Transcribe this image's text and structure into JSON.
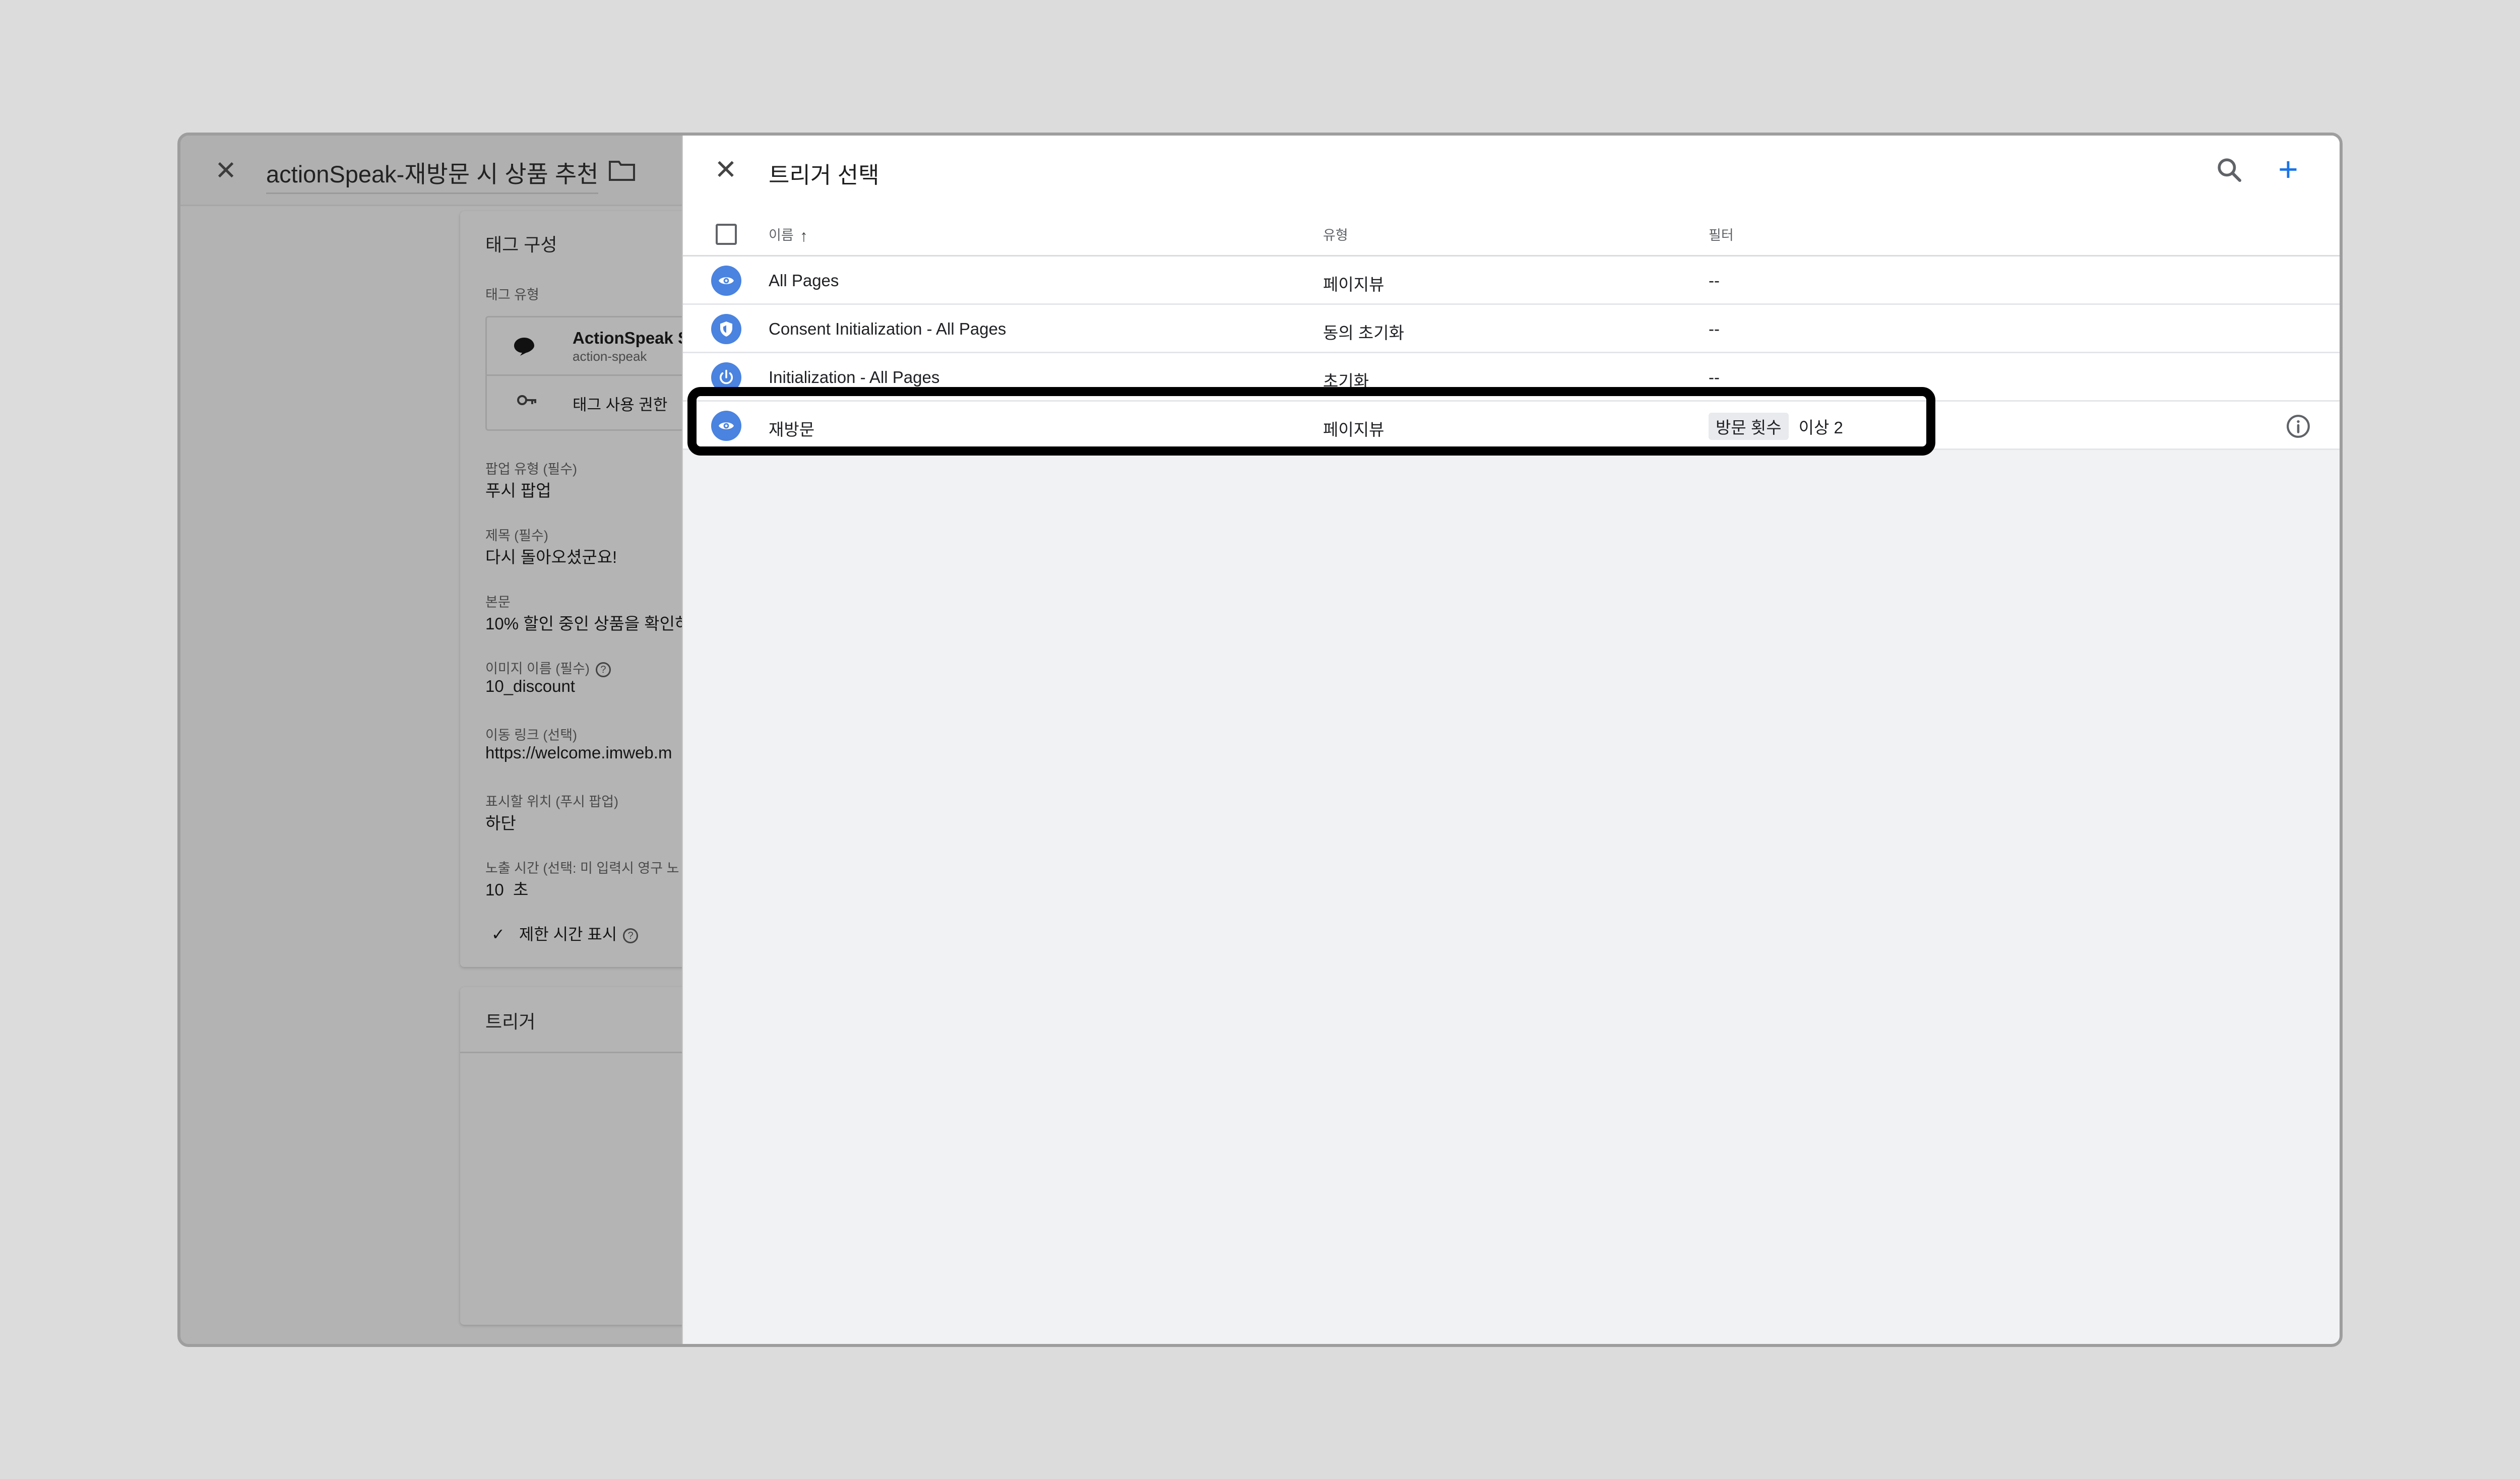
{
  "tag_editor": {
    "title": "actionSpeak-재방문 시 상품 추천",
    "section_title": "태그 구성",
    "tag_type_label": "태그 유형",
    "tag_type_name": "ActionSpeak S",
    "tag_type_id": "action-speak",
    "permission_label": "태그 사용 권한",
    "fields": [
      {
        "label": "팝업 유형 (필수)",
        "value": "푸시 팝업"
      },
      {
        "label": "제목 (필수)",
        "value": "다시 돌아오셨군요!"
      },
      {
        "label": "본문",
        "value": "10% 할인 중인 상품을 확인하"
      },
      {
        "label": "이미지 이름 (필수)",
        "value": "10_discount"
      },
      {
        "label": "이동 링크 (선택)",
        "value": "https://welcome.imweb.m"
      },
      {
        "label": "표시할 위치 (푸시 팝업)",
        "value": "하단"
      },
      {
        "label": "노출 시간 (선택: 미 입력시 영구 노",
        "value": "10  초"
      }
    ],
    "checkbox_label": "제한 시간 표시",
    "trigger_section_title": "트리거"
  },
  "trigger_picker": {
    "title": "트리거 선택",
    "columns": {
      "name": "이름",
      "type": "유형",
      "filter": "필터"
    },
    "rows": [
      {
        "name": "All Pages",
        "type": "페이지뷰",
        "filter": "--",
        "icon": "eye-icon"
      },
      {
        "name": "Consent Initialization - All Pages",
        "type": "동의 초기화",
        "filter": "--",
        "icon": "shield-icon"
      },
      {
        "name": "Initialization - All Pages",
        "type": "초기화",
        "filter": "--",
        "icon": "power-icon"
      },
      {
        "name": "재방문",
        "type": "페이지뷰",
        "filter_chip": "방문 횟수",
        "filter_value": "이상 2",
        "icon": "eye-icon"
      }
    ]
  },
  "colors": {
    "accent": "#1a73e8",
    "icon_blue": "#4a83e0",
    "highlight": "#000000"
  }
}
